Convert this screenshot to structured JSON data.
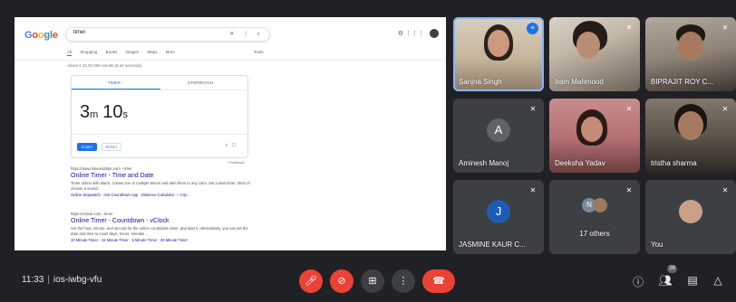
{
  "shared_screen": {
    "logo": [
      "G",
      "o",
      "o",
      "g",
      "l",
      "e"
    ],
    "search_query": "timer",
    "search_icons": "✕ ⋮ ⌕",
    "top_right_icons": "⚙ ⋮⋮⋮",
    "tabs": [
      "All",
      "Shopping",
      "Books",
      "Images",
      "Maps",
      "More"
    ],
    "tools": "Tools",
    "result_count": "About 4,42,00,000 results (0.44 seconds)",
    "timer": {
      "tab_timer": "TIMER",
      "tab_stopwatch": "STOPWATCH",
      "minutes": "3",
      "minutes_unit": "m",
      "seconds": "10",
      "seconds_unit": "s",
      "start": "START",
      "reset": "RESET",
      "feedback": "Feedback"
    },
    "results": [
      {
        "url": "https://www.timeanddate.com › timer",
        "title": "Online Timer - Time and Date",
        "snippet": "Timer online with alarm. Create one or multiple timers and alert them to any color. Set a start timer, short of choose a sound.",
        "links": "Online Stopwatch · iOS Countdown App · Distance Calculator — City..."
      },
      {
        "url": "https://vclock.com › timer",
        "title": "Online Timer - Countdown - vClock",
        "snippet": "Set the hour, minute, and second for the online countdown timer, and start it. Alternatively, you can set the date and time to count days, hours, minutes ...",
        "links": "10 Minute Timer · 15 Minute Timer · 5 Minute Timer · 20 Minute Timer"
      }
    ]
  },
  "participants": [
    {
      "name": "Sanjna Singh",
      "state": "speaking"
    },
    {
      "name": "Iram Mahmood",
      "state": "muted"
    },
    {
      "name": "BIPRAJIT ROY C...",
      "state": "muted"
    },
    {
      "name": "Aminesh Manoj",
      "state": "muted",
      "initial": "A",
      "color": "#5f6368"
    },
    {
      "name": "Deeksha Yadav",
      "state": "muted"
    },
    {
      "name": "tristha sharma",
      "state": "muted"
    },
    {
      "name": "JASMINE KAUR C...",
      "state": "muted",
      "initial": "J",
      "color": "#1e5cb3"
    },
    {
      "name": "17 others",
      "state": "muted",
      "initial": "N"
    },
    {
      "name": "You",
      "state": "muted"
    }
  ],
  "meeting": {
    "time": "11:33",
    "separator": "|",
    "code": "ios-iwbg-vfu",
    "participant_count": "26"
  },
  "colors": {
    "background": "#202124",
    "tile": "#3c4043",
    "red": "#ea4335",
    "accent": "#1a73e8"
  }
}
